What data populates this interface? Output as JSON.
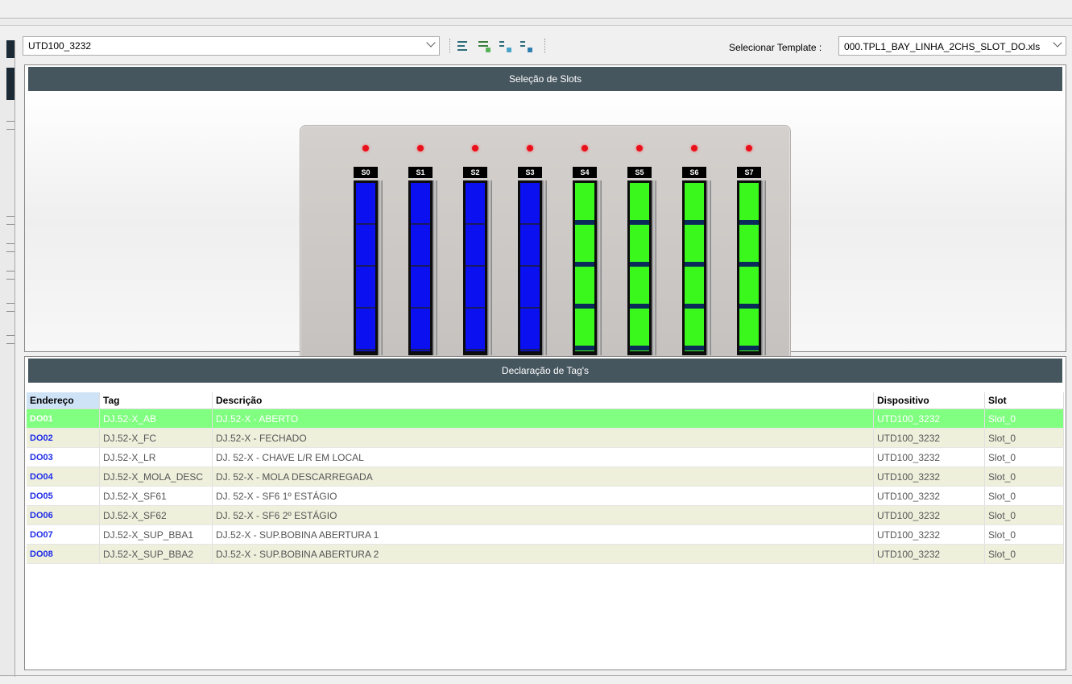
{
  "toolbar": {
    "device_value": "UTD100_3232",
    "template_label": "Selecionar Template :",
    "template_value": "000.TPL1_BAY_LINHA_2CHS_SLOT_DO.xls"
  },
  "slots_panel": {
    "title": "Seleção de Slots",
    "slots": [
      {
        "label": "S0",
        "state": "blue"
      },
      {
        "label": "S1",
        "state": "blue"
      },
      {
        "label": "S2",
        "state": "blue"
      },
      {
        "label": "S3",
        "state": "blue"
      },
      {
        "label": "S4",
        "state": "green"
      },
      {
        "label": "S5",
        "state": "green"
      },
      {
        "label": "S6",
        "state": "green"
      },
      {
        "label": "S7",
        "state": "green"
      }
    ]
  },
  "tags_panel": {
    "title": "Declaração de Tag's",
    "columns": [
      "Endereço",
      "Tag",
      "Descrição",
      "Dispositivo",
      "Slot"
    ],
    "rows": [
      [
        "DO01",
        "DJ.52-X_AB",
        "DJ.52-X - ABERTO",
        "UTD100_3232",
        "Slot_0"
      ],
      [
        "DO02",
        "DJ.52-X_FC",
        "DJ.52-X - FECHADO",
        "UTD100_3232",
        "Slot_0"
      ],
      [
        "DO03",
        "DJ.52-X_LR",
        "DJ. 52-X - CHAVE L/R EM LOCAL",
        "UTD100_3232",
        "Slot_0"
      ],
      [
        "DO04",
        "DJ.52-X_MOLA_DESC",
        "DJ. 52-X - MOLA DESCARREGADA",
        "UTD100_3232",
        "Slot_0"
      ],
      [
        "DO05",
        "DJ.52-X_SF61",
        "DJ. 52-X - SF6 1º ESTÁGIO",
        "UTD100_3232",
        "Slot_0"
      ],
      [
        "DO06",
        "DJ.52-X_SF62",
        "DJ. 52-X - SF6 2º ESTÁGIO",
        "UTD100_3232",
        "Slot_0"
      ],
      [
        "DO07",
        "DJ.52-X_SUP_BBA1",
        "DJ.52-X - SUP.BOBINA ABERTURA 1",
        "UTD100_3232",
        "Slot_0"
      ],
      [
        "DO08",
        "DJ.52-X_SUP_BBA2",
        "DJ.52-X - SUP.BOBINA ABERTURA 2",
        "UTD100_3232",
        "Slot_0"
      ]
    ],
    "selected_row": 0
  },
  "colors": {
    "header_bg": "#46565f",
    "slot_blue": "#0a10f0",
    "slot_green": "#3af81c",
    "selected_row": "#80ff80",
    "address_text": "#1e2be8"
  }
}
